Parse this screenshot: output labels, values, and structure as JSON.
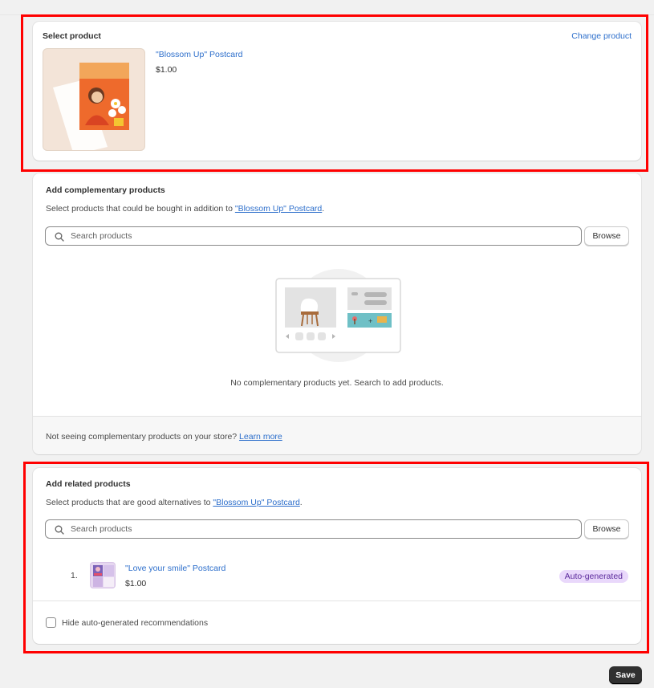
{
  "select_product": {
    "title": "Select product",
    "change_link": "Change product",
    "product_name": "\"Blossom Up\" Postcard",
    "product_price": "$1.00"
  },
  "complementary": {
    "title": "Add complementary products",
    "subtitle_prefix": "Select products that could be bought in addition to ",
    "subtitle_link": "\"Blossom Up\" Postcard",
    "subtitle_suffix": ".",
    "search_placeholder": "Search products",
    "browse_label": "Browse",
    "empty_text": "No complementary products yet. Search to add products.",
    "footer_prefix": "Not seeing complementary products on your store? ",
    "footer_link": "Learn more"
  },
  "related": {
    "title": "Add related products",
    "subtitle_prefix": "Select products that are good alternatives to ",
    "subtitle_link": "\"Blossom Up\" Postcard",
    "subtitle_suffix": ".",
    "search_placeholder": "Search products",
    "browse_label": "Browse",
    "items": [
      {
        "index": "1.",
        "name": "\"Love your smile\" Postcard",
        "price": "$1.00",
        "badge": "Auto-generated"
      }
    ],
    "hide_checkbox_label": "Hide auto-generated recommendations",
    "hide_checked": false
  },
  "save_label": "Save",
  "colors": {
    "highlight": "#ff0000",
    "link": "#2c6ecb",
    "badge_bg": "#e9d8fb",
    "badge_text": "#5b2a9c",
    "save_bg": "#303030"
  }
}
